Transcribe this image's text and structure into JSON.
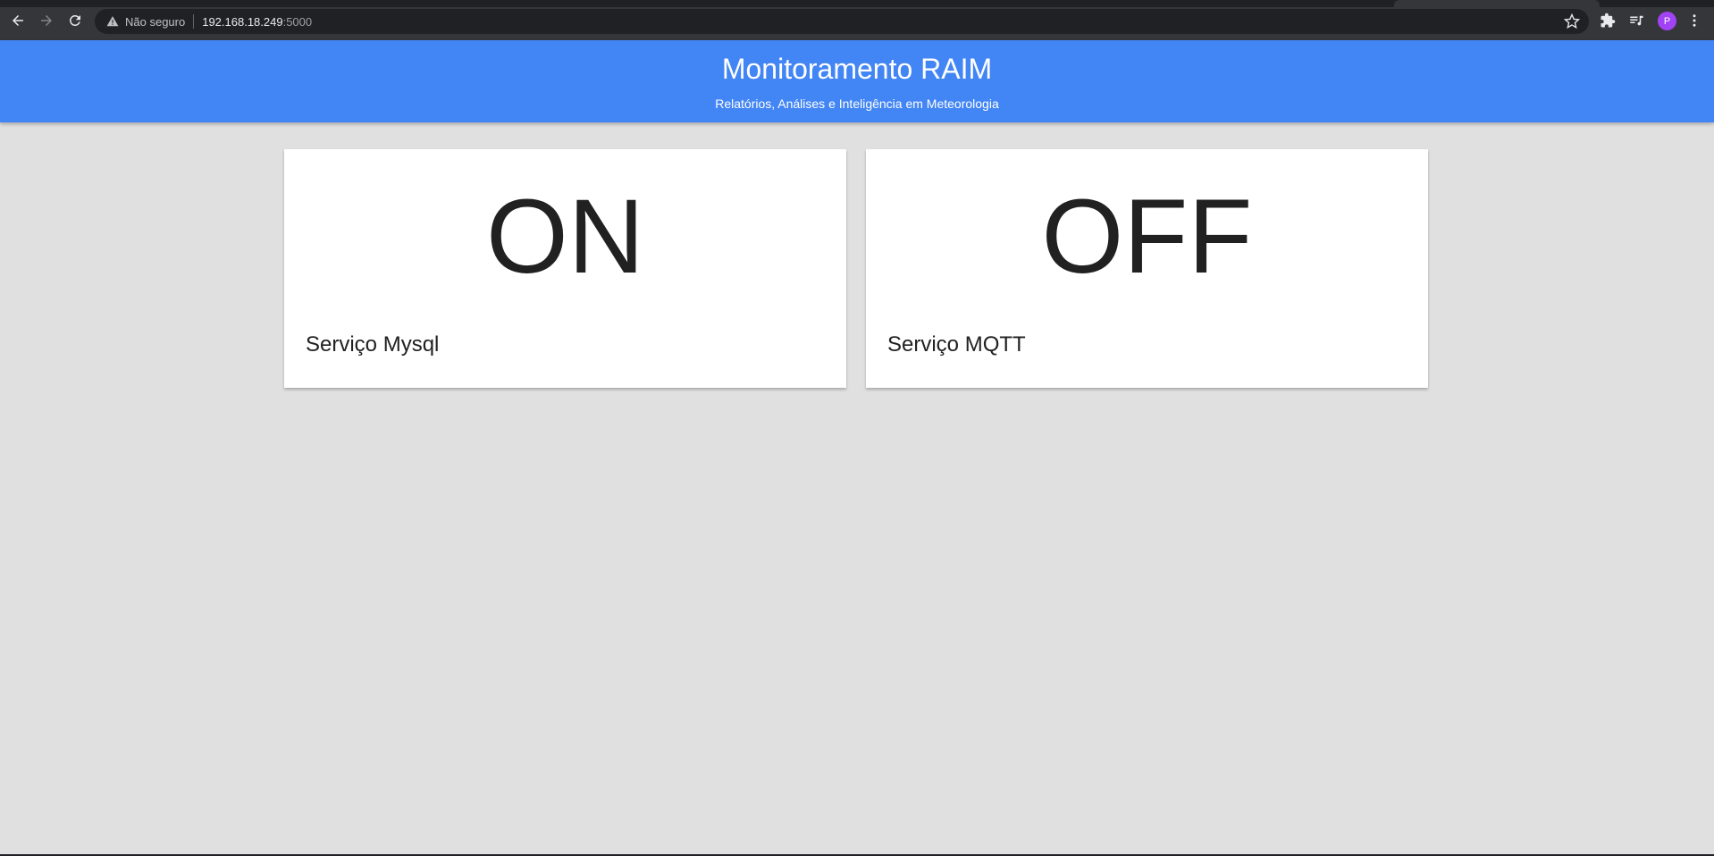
{
  "browser": {
    "security_label": "Não seguro",
    "url_host": "192.168.18.249",
    "url_port": ":5000",
    "profile_initial": "P"
  },
  "header": {
    "title": "Monitoramento RAIM",
    "subtitle": "Relatórios, Análises e Inteligência em Meteorologia",
    "color": "#4285f4"
  },
  "cards": [
    {
      "status": "ON",
      "label": "Serviço Mysql"
    },
    {
      "status": "OFF",
      "label": "Serviço MQTT"
    }
  ],
  "icons": [
    "back-icon",
    "forward-icon",
    "reload-icon",
    "warning-icon",
    "bookmark-star-icon",
    "extensions-icon",
    "media-queue-icon",
    "menu-dots-icon"
  ]
}
